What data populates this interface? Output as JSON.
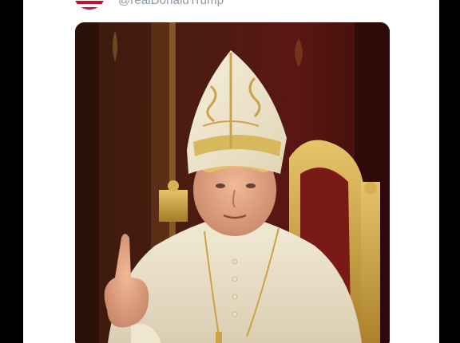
{
  "post": {
    "handle": "@realDonaldTrump",
    "avatar_icon": "flag-avatar-icon",
    "image_description_icon": "portrait-image"
  },
  "colors": {
    "page_background": "#000000",
    "card_background": "#ffffff",
    "handle_text": "#8b98a5",
    "accent_gold": "#c9a24a"
  }
}
